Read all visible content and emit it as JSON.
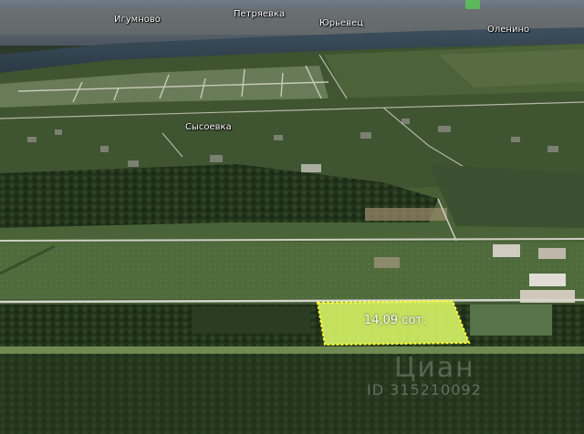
{
  "map": {
    "places": [
      {
        "name": "Игумново",
        "key": "igumnovo"
      },
      {
        "name": "Петряевка",
        "key": "petryaevka"
      },
      {
        "name": "Юрьевец",
        "key": "yurevets"
      },
      {
        "name": "Оленино",
        "key": "olenino"
      },
      {
        "name": "Сысоевка",
        "key": "sysoevka"
      }
    ],
    "plot": {
      "area_label": "14,09 сот.",
      "outline_color": "#ffff33",
      "fill_color": "#e6ff66"
    },
    "watermark": {
      "brand": "Циан",
      "id_text": "ID 315210092"
    },
    "colors": {
      "field": "#4e6b3a",
      "forest": "#27391f",
      "road": "#c9c9c0",
      "water": "#3a4a52"
    }
  }
}
